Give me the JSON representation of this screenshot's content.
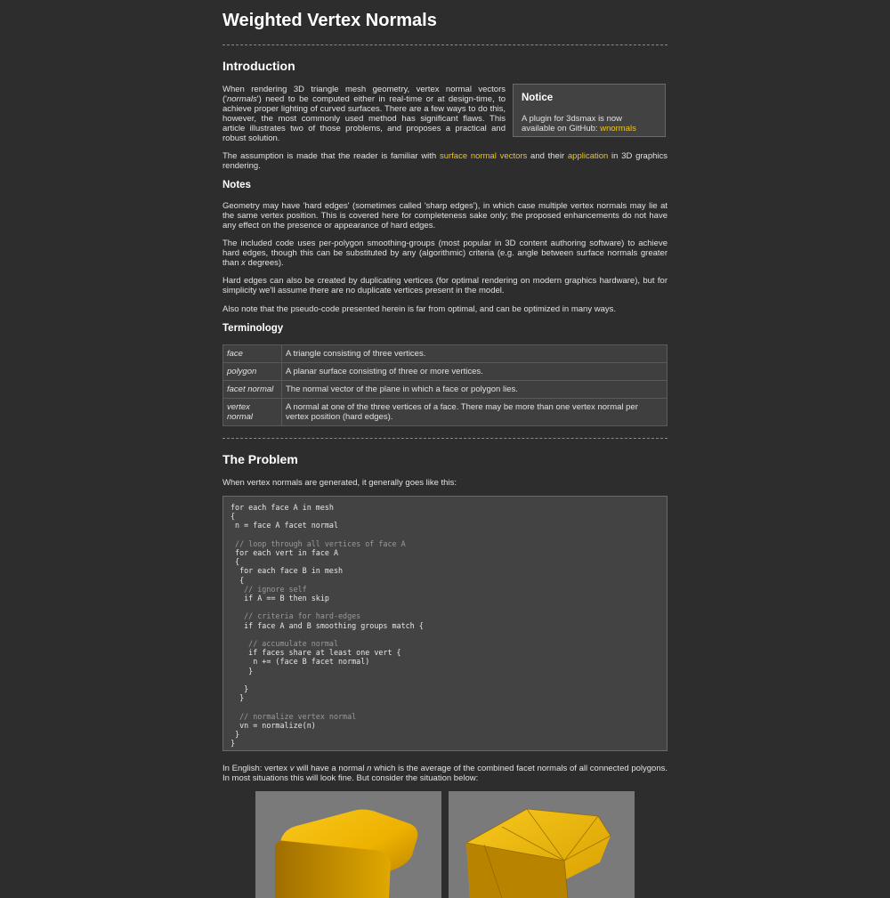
{
  "title": "Weighted Vertex Normals",
  "intro": {
    "heading": "Introduction",
    "p1_pre": "When rendering 3D triangle mesh geometry, vertex normal vectors ('",
    "p1_em": "normals",
    "p1_post": "') need to be computed either in real-time or at design-time, to achieve proper lighting of curved surfaces. There are a few ways to do this, however, the most commonly used method has significant flaws. This article illustrates two of those problems, and proposes a practical and robust solution.",
    "p2_pre": "The assumption is made that the reader is familiar with ",
    "p2_link1": "surface normal vectors",
    "p2_mid": " and their ",
    "p2_link2": "application",
    "p2_post": " in 3D graphics rendering."
  },
  "notice": {
    "heading": "Notice",
    "text": "A plugin for 3dsmax is now available on GitHub: ",
    "link": "wnormals"
  },
  "notes": {
    "heading": "Notes",
    "p1": "Geometry may have 'hard edges' (sometimes called 'sharp edges'), in which case multiple vertex normals may lie at the same vertex position. This is covered here for completeness sake only; the proposed enhancements do not have any effect on the presence or appearance of hard edges.",
    "p2_pre": "The included code uses per-polygon smoothing-groups (most popular in 3D content authoring software) to achieve hard edges, though this can be substituted by any (algorithmic) criteria (e.g. angle between surface normals greater than ",
    "p2_em": "x",
    "p2_post": " degrees).",
    "p3": "Hard edges can also be created by duplicating vertices (for optimal rendering on modern graphics hardware), but for simplicity we'll assume there are no duplicate vertices present in the model.",
    "p4": "Also note that the pseudo-code presented herein is far from optimal, and can be optimized in many ways."
  },
  "terminology": {
    "heading": "Terminology",
    "rows": [
      {
        "term": "face",
        "def": "A triangle consisting of three vertices."
      },
      {
        "term": "polygon",
        "def": "A planar surface consisting of three or more vertices."
      },
      {
        "term": "facet normal",
        "def": "The normal vector of the plane in which a face or polygon lies."
      },
      {
        "term": "vertex normal",
        "def": "A normal at one of the three vertices of a face. There may be more than one vertex normal per vertex position (hard edges)."
      }
    ]
  },
  "problem": {
    "heading": "The Problem",
    "intro": "When vertex normals are generated, it generally goes like this:",
    "code": [
      {
        "t": "for each face A in mesh",
        "c": false
      },
      {
        "t": "{",
        "c": false
      },
      {
        "t": " n = face A facet normal",
        "c": false
      },
      {
        "t": "",
        "c": false
      },
      {
        "t": " // loop through all vertices of face A",
        "c": true
      },
      {
        "t": " for each vert in face A",
        "c": false
      },
      {
        "t": " {",
        "c": false
      },
      {
        "t": "  for each face B in mesh",
        "c": false
      },
      {
        "t": "  {",
        "c": false
      },
      {
        "t": "   // ignore self",
        "c": true
      },
      {
        "t": "   if A == B then skip",
        "c": false
      },
      {
        "t": "",
        "c": false
      },
      {
        "t": "   // criteria for hard-edges",
        "c": true
      },
      {
        "t": "   if face A and B smoothing groups match {",
        "c": false
      },
      {
        "t": "",
        "c": false
      },
      {
        "t": "    // accumulate normal",
        "c": true
      },
      {
        "t": "    if faces share at least one vert {",
        "c": false
      },
      {
        "t": "     n += (face B facet normal)",
        "c": false
      },
      {
        "t": "    }",
        "c": false
      },
      {
        "t": "",
        "c": false
      },
      {
        "t": "   }",
        "c": false
      },
      {
        "t": "  }",
        "c": false
      },
      {
        "t": "",
        "c": false
      },
      {
        "t": "  // normalize vertex normal",
        "c": true
      },
      {
        "t": "  vn = normalize(n)",
        "c": false
      },
      {
        "t": " }",
        "c": false
      },
      {
        "t": "}",
        "c": false
      }
    ],
    "after_pre": "In English: vertex ",
    "after_em1": "v",
    "after_mid": " will have a normal ",
    "after_em2": "n",
    "after_post": " which is the average of the combined facet normals of all connected polygons. In most situations this will look fine. But consider the situation below:"
  },
  "colors": {
    "background": "#2d2d2d",
    "link": "#f0c419",
    "cube": "#f2b600"
  }
}
